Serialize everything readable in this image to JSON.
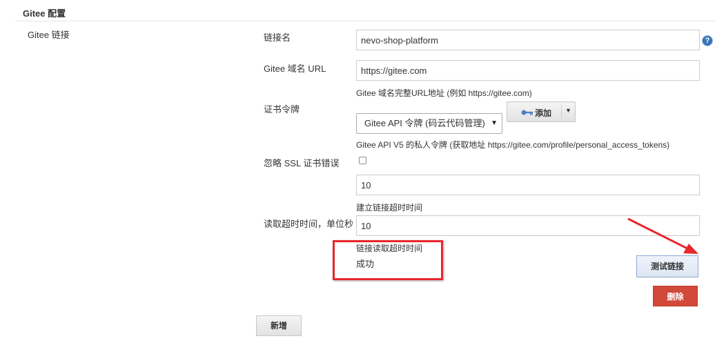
{
  "section": {
    "title": "Gitee 配置"
  },
  "item": {
    "label": "Gitee 链接"
  },
  "form": {
    "name": {
      "label": "链接名",
      "value": "nevo-shop-platform"
    },
    "url": {
      "label": "Gitee 域名 URL",
      "value": "https://gitee.com",
      "hint": "Gitee 域名完整URL地址 (例如 https://gitee.com)"
    },
    "credential": {
      "label": "证书令牌",
      "selected": "Gitee API 令牌 (码云代码管理)",
      "add_label": "添加",
      "hint": "Gitee API V5 的私人令牌 (获取地址 https://gitee.com/profile/personal_access_tokens)"
    },
    "ignore_ssl": {
      "label": "忽略 SSL 证书错误",
      "checked": false
    },
    "connect_timeout": {
      "value": "10",
      "hint": "建立链接超时时间"
    },
    "read_timeout": {
      "label": "读取超时时间，单位秒",
      "value": "10",
      "hint": "链接读取超时时间"
    },
    "status": "成功"
  },
  "buttons": {
    "test": "测试链接",
    "delete": "删除",
    "new": "新增"
  },
  "icons": {
    "help": "help-icon",
    "key": "key-icon",
    "dropdown": "caret-down-icon",
    "arrow": "annotation-arrow-icon"
  },
  "colors": {
    "annotation_red": "#e8262c",
    "delete_red": "#d24939",
    "help_blue": "#3a74b6"
  }
}
